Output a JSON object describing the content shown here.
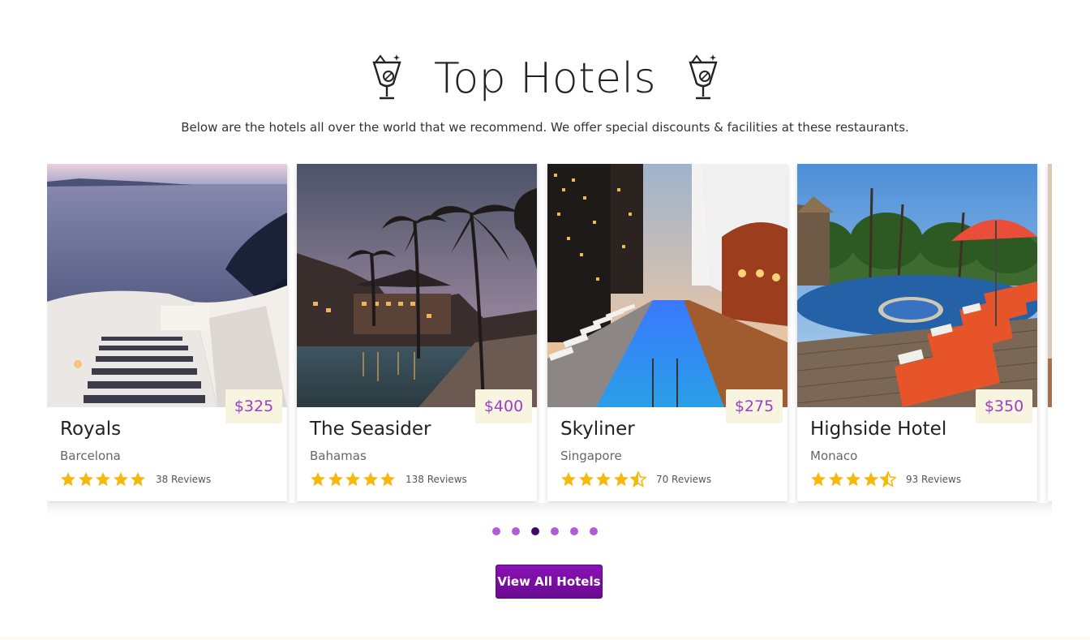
{
  "section": {
    "title": "Top Hotels",
    "subtitle": "Below are the hotels all over the world that we recommend. We offer special discounts & facilities at these restaurants.",
    "icon": "cocktail-glass-icon"
  },
  "hotels": [
    {
      "name": "Royals",
      "city": "Barcelona",
      "price": "$325",
      "rating": 5,
      "reviews": "38 Reviews",
      "image": "santorini-sea-steps"
    },
    {
      "name": "The Seasider",
      "city": "Bahamas",
      "price": "$400",
      "rating": 5,
      "reviews": "138 Reviews",
      "image": "palm-resort-dusk"
    },
    {
      "name": "Skyliner",
      "city": "Singapore",
      "price": "$275",
      "rating": 4.5,
      "reviews": "70 Reviews",
      "image": "rooftop-pool-night"
    },
    {
      "name": "Highside Hotel",
      "city": "Monaco",
      "price": "$350",
      "rating": 4.5,
      "reviews": "93 Reviews",
      "image": "poolside-loungers"
    }
  ],
  "carousel": {
    "dot_count": 6,
    "active_index": 2
  },
  "button": {
    "label": "View All Hotels"
  },
  "colors": {
    "accent": "#6a0a92",
    "price": "#9c3ec7",
    "star": "#f5b90d",
    "dot": "#b45ad8",
    "dot_active": "#3f0a66",
    "badge_bg": "#f7f5df"
  }
}
